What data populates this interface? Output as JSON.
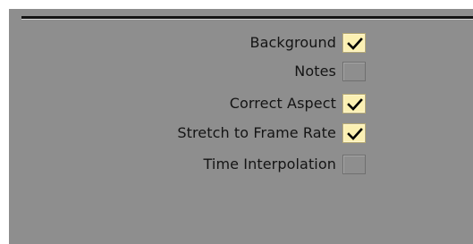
{
  "options": [
    {
      "label": "Background",
      "checked": true
    },
    {
      "label": "Notes",
      "checked": false
    },
    {
      "label": "Correct Aspect",
      "checked": true
    },
    {
      "label": "Stretch to Frame Rate",
      "checked": true
    },
    {
      "label": "Time Interpolation",
      "checked": false
    }
  ],
  "colors": {
    "panel_bg": "#8e8e8e",
    "checked_bg": "#fbf0b2",
    "checkmark": "#000000",
    "label_text": "#141414"
  },
  "icons": {
    "check": "checkmark-icon"
  }
}
